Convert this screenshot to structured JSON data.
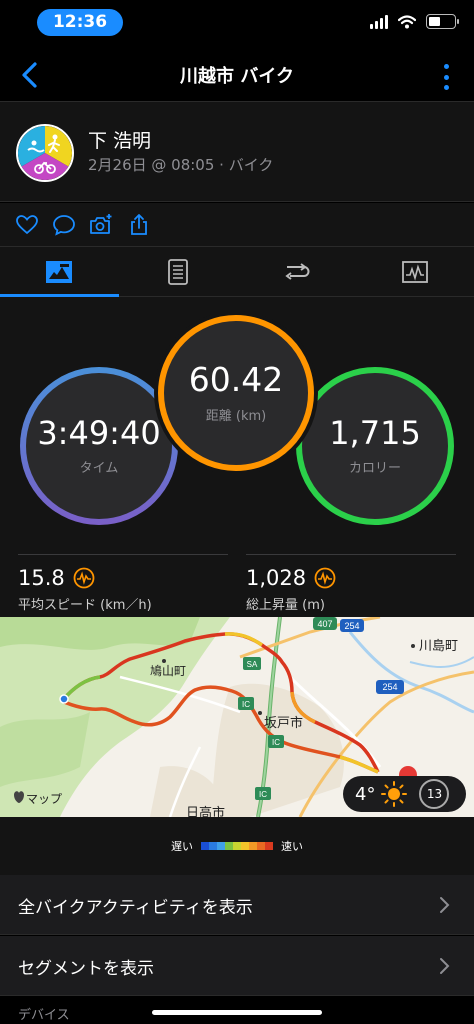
{
  "status_bar": {
    "time": "12:36",
    "battery_level": 0.45
  },
  "nav": {
    "title": "川越市 バイク"
  },
  "activity": {
    "user_name": "下 浩明",
    "meta": "2月26日 @ 08:05 · バイク"
  },
  "stats": {
    "time": {
      "value": "3:49:40",
      "label": "タイム"
    },
    "distance": {
      "value": "60.42",
      "label": "距離 (km)"
    },
    "calories": {
      "value": "1,715",
      "label": "カロリー"
    },
    "avg_speed": {
      "value": "15.8",
      "label": "平均スピード (km／h)"
    },
    "elevation_gain": {
      "value": "1,028",
      "label": "総上昇量 (m)"
    }
  },
  "map": {
    "labels": {
      "kawajima": "川島町",
      "hatoyama": "鳩山町",
      "sakado": "坂戸市",
      "hidaka": "日高市"
    },
    "road_407": "407",
    "road_254a": "254",
    "road_254b": "254",
    "sa": "SA",
    "ic1": "IC",
    "ic2": "IC",
    "ic3": "IC",
    "attribution": "マップ",
    "weather_temp": "4°",
    "wind": "13"
  },
  "legend": {
    "slow": "遅い",
    "fast": "速い",
    "colors": [
      "#1a4fd6",
      "#2a7be0",
      "#3fa0e8",
      "#7cc242",
      "#c8d531",
      "#f2c42a",
      "#f39a26",
      "#e96a22",
      "#d93a1f"
    ]
  },
  "list": {
    "all_activities": "全バイクアクティビティを表示",
    "segments": "セグメントを表示"
  },
  "section": {
    "devices": "デバイス"
  }
}
